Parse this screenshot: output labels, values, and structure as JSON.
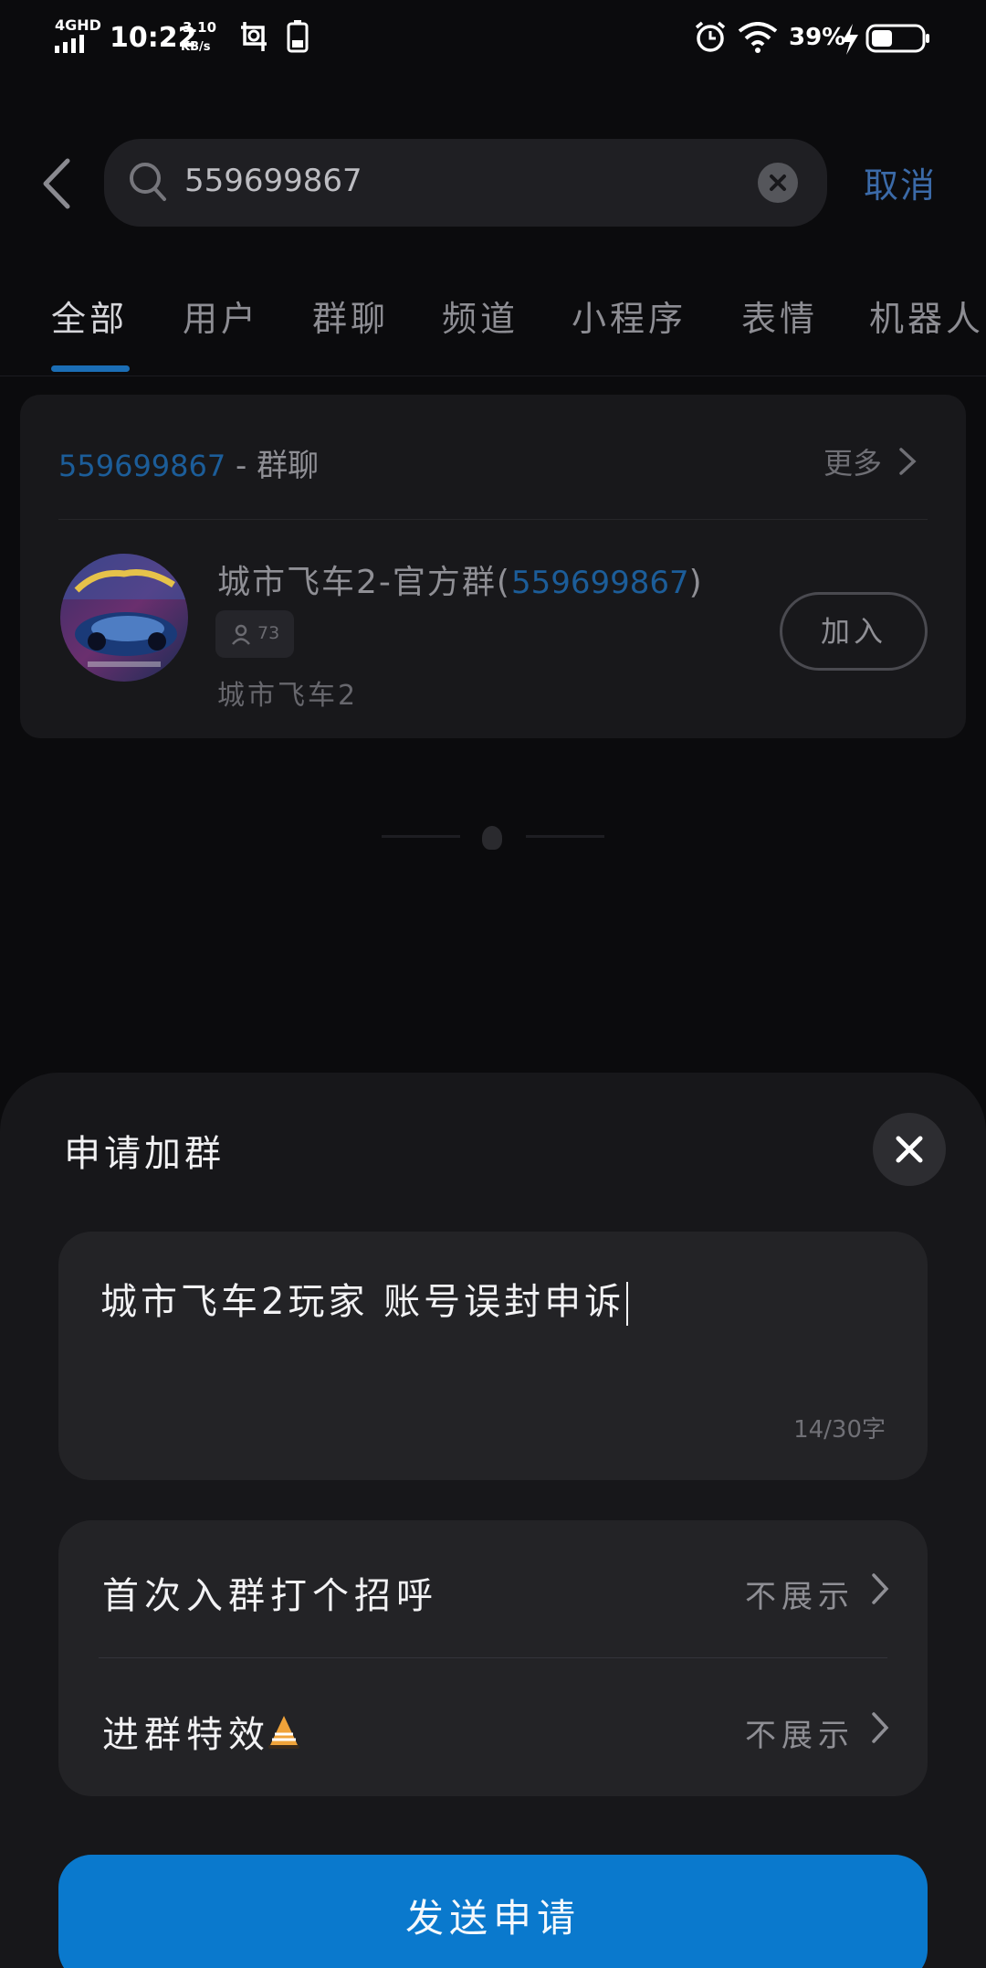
{
  "status_bar": {
    "network": "4GHD",
    "time": "10:22",
    "speed_value": "3.10",
    "speed_unit": "KB/s",
    "battery_pct": "39%",
    "icons": [
      "signal-icon",
      "screenshot-icon",
      "phone-battery-icon",
      "alarm-icon",
      "wifi-icon",
      "charging-icon",
      "battery-icon"
    ]
  },
  "search": {
    "query": "559699867",
    "cancel_label": "取消"
  },
  "tabs": [
    {
      "label": "全部",
      "active": true
    },
    {
      "label": "用户"
    },
    {
      "label": "群聊"
    },
    {
      "label": "频道"
    },
    {
      "label": "小程序"
    },
    {
      "label": "表情"
    },
    {
      "label": "机器人"
    }
  ],
  "result": {
    "keyword": "559699867",
    "category_suffix": " - 群聊",
    "more_label": "更多",
    "group": {
      "name_prefix": "城市飞车2-官方群(",
      "name_id": "559699867",
      "name_suffix": ")",
      "members": "73",
      "description": "城市飞车2",
      "join_label": "加入"
    }
  },
  "sheet": {
    "title": "申请加群",
    "message": "城市飞车2玩家 账号误封申诉",
    "char_count": "14/30字",
    "options": [
      {
        "label": "首次入群打个招呼",
        "value": "不展示"
      },
      {
        "label": "进群特效",
        "value": "不展示"
      }
    ],
    "send_label": "发送申请"
  },
  "colors": {
    "accent": "#0a79cd",
    "keyword": "#1c5d99",
    "cancel": "#3b6aa8"
  }
}
